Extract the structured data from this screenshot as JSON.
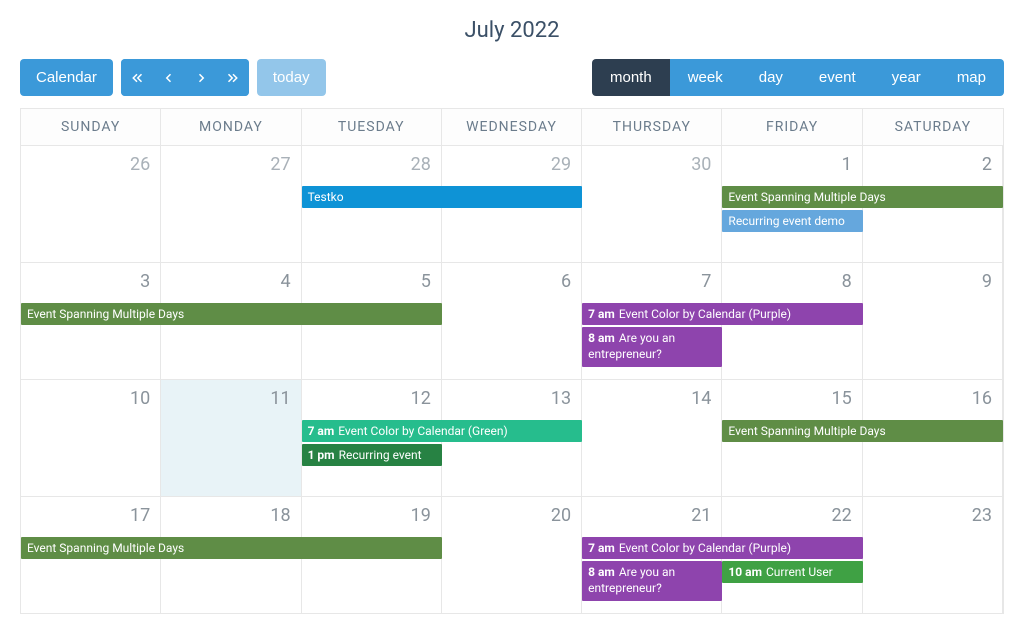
{
  "title": "July 2022",
  "toolbar": {
    "calendar_label": "Calendar",
    "today_label": "today"
  },
  "views": [
    {
      "key": "month",
      "label": "month",
      "active": true
    },
    {
      "key": "week",
      "label": "week",
      "active": false
    },
    {
      "key": "day",
      "label": "day",
      "active": false
    },
    {
      "key": "event",
      "label": "event",
      "active": false
    },
    {
      "key": "year",
      "label": "year",
      "active": false
    },
    {
      "key": "map",
      "label": "map",
      "active": false
    }
  ],
  "day_headers": [
    "SUNDAY",
    "MONDAY",
    "TUESDAY",
    "WEDNESDAY",
    "THURSDAY",
    "FRIDAY",
    "SATURDAY"
  ],
  "weeks": [
    {
      "days": [
        {
          "num": 26,
          "inmonth": false
        },
        {
          "num": 27,
          "inmonth": false
        },
        {
          "num": 28,
          "inmonth": false
        },
        {
          "num": 29,
          "inmonth": false
        },
        {
          "num": 30,
          "inmonth": false
        },
        {
          "num": 1,
          "inmonth": true
        },
        {
          "num": 2,
          "inmonth": true
        }
      ],
      "events": [
        {
          "col": 2,
          "span": 2,
          "row": 0,
          "title": "Testko",
          "color": "#0e93d6",
          "time": ""
        },
        {
          "col": 5,
          "span": 2,
          "row": 0,
          "title": "Event Spanning Multiple Days",
          "color": "#5f8d46",
          "time": ""
        },
        {
          "col": 5,
          "span": 1,
          "row": 1,
          "title": "Recurring event demo",
          "color": "#65a7dd",
          "time": ""
        }
      ]
    },
    {
      "days": [
        {
          "num": 3,
          "inmonth": true
        },
        {
          "num": 4,
          "inmonth": true
        },
        {
          "num": 5,
          "inmonth": true
        },
        {
          "num": 6,
          "inmonth": true
        },
        {
          "num": 7,
          "inmonth": true
        },
        {
          "num": 8,
          "inmonth": true
        },
        {
          "num": 9,
          "inmonth": true
        }
      ],
      "events": [
        {
          "col": 0,
          "span": 3,
          "row": 0,
          "title": "Event Spanning Multiple Days",
          "color": "#5f8d46",
          "time": ""
        },
        {
          "col": 4,
          "span": 2,
          "row": 0,
          "title": "Event Color by Calendar (Purple)",
          "color": "#8e44ad",
          "time": "7 am"
        },
        {
          "col": 4,
          "span": 1,
          "row": 1,
          "title": "Are you an entrepreneur?",
          "color": "#8e44ad",
          "time": "8 am",
          "tall": true
        }
      ]
    },
    {
      "days": [
        {
          "num": 10,
          "inmonth": true
        },
        {
          "num": 11,
          "inmonth": true,
          "today": true
        },
        {
          "num": 12,
          "inmonth": true
        },
        {
          "num": 13,
          "inmonth": true
        },
        {
          "num": 14,
          "inmonth": true
        },
        {
          "num": 15,
          "inmonth": true
        },
        {
          "num": 16,
          "inmonth": true
        }
      ],
      "events": [
        {
          "col": 2,
          "span": 2,
          "row": 0,
          "title": "Event Color by Calendar (Green)",
          "color": "#26bd8d",
          "time": "7 am"
        },
        {
          "col": 5,
          "span": 2,
          "row": 0,
          "title": "Event Spanning Multiple Days",
          "color": "#5f8d46",
          "time": ""
        },
        {
          "col": 2,
          "span": 1,
          "row": 1,
          "title": "Recurring event",
          "color": "#278243",
          "time": "1 pm"
        }
      ]
    },
    {
      "days": [
        {
          "num": 17,
          "inmonth": true
        },
        {
          "num": 18,
          "inmonth": true
        },
        {
          "num": 19,
          "inmonth": true
        },
        {
          "num": 20,
          "inmonth": true
        },
        {
          "num": 21,
          "inmonth": true
        },
        {
          "num": 22,
          "inmonth": true
        },
        {
          "num": 23,
          "inmonth": true
        }
      ],
      "events": [
        {
          "col": 0,
          "span": 3,
          "row": 0,
          "title": "Event Spanning Multiple Days",
          "color": "#5f8d46",
          "time": ""
        },
        {
          "col": 4,
          "span": 2,
          "row": 0,
          "title": "Event Color by Calendar (Purple)",
          "color": "#8e44ad",
          "time": "7 am"
        },
        {
          "col": 4,
          "span": 1,
          "row": 1,
          "title": "Are you an entrepreneur?",
          "color": "#8e44ad",
          "time": "8 am",
          "tall": true
        },
        {
          "col": 5,
          "span": 1,
          "row": 1,
          "title": "Current User",
          "color": "#3fa144",
          "time": "10 am"
        }
      ]
    }
  ]
}
